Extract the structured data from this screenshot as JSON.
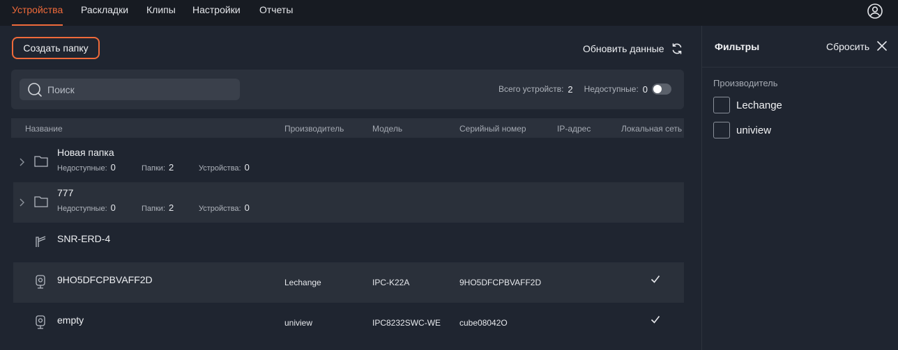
{
  "nav": {
    "tabs": [
      "Устройства",
      "Раскладки",
      "Клипы",
      "Настройки",
      "Отчеты"
    ],
    "active_tab": "Устройства",
    "accent_color": "#ef6a3a"
  },
  "toolbar": {
    "create_folder_label": "Создать папку",
    "refresh_label": "Обновить данные"
  },
  "search": {
    "placeholder": "Поиск",
    "total_label": "Всего устройств:",
    "total_value": "2",
    "unavailable_label": "Недоступные:",
    "unavailable_value": "0"
  },
  "table": {
    "columns": [
      "Название",
      "Производитель",
      "Модель",
      "Серийный номер",
      "IP-адрес",
      "Локальная сеть"
    ],
    "rows": [
      {
        "type": "folder",
        "name": "Новая папка",
        "unavailable_label": "Недоступные:",
        "unavailable": "0",
        "folders_label": "Папки:",
        "folders": "2",
        "devices_label": "Устройства:",
        "devices": "0"
      },
      {
        "type": "folder",
        "name": "777",
        "unavailable_label": "Недоступные:",
        "unavailable": "0",
        "folders_label": "Папки:",
        "folders": "2",
        "devices_label": "Устройства:",
        "devices": "0"
      },
      {
        "type": "barrier",
        "name": "SNR-ERD-4"
      },
      {
        "type": "camera",
        "name": "9HO5DFCPBVAFF2D",
        "vendor": "Lechange",
        "model": "IPC-K22A",
        "serial": "9HO5DFCPBVAFF2D",
        "local_network": true
      },
      {
        "type": "camera",
        "name": "empty",
        "vendor": "uniview",
        "model": "IPC8232SWC-WE",
        "serial": "cube08042O",
        "local_network": true
      }
    ]
  },
  "filters": {
    "title": "Фильтры",
    "reset_label": "Сбросить",
    "section_label": "Производитель",
    "options": [
      {
        "label": "Lechange",
        "checked": false
      },
      {
        "label": "uniview",
        "checked": false
      }
    ]
  }
}
